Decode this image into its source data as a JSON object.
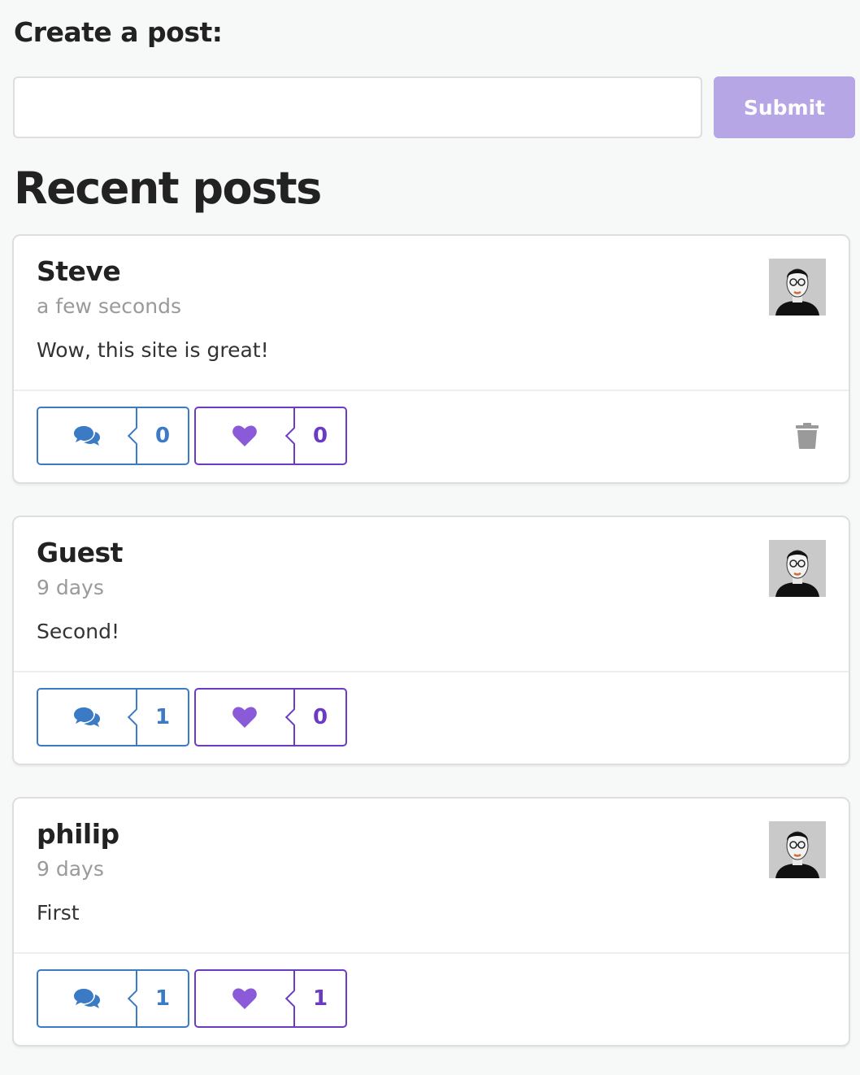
{
  "create": {
    "title": "Create a post:",
    "input_value": "",
    "input_placeholder": "",
    "submit_label": "Submit"
  },
  "recent": {
    "title": "Recent posts"
  },
  "colors": {
    "accent_blue": "#3b7ac5",
    "accent_purple": "#6b3bc4",
    "heart": "#8a5ad9",
    "submit_disabled": "#b6a6e6"
  },
  "posts": [
    {
      "author": "Steve",
      "time": "a few seconds",
      "body": "Wow, this site is great!",
      "comments": "0",
      "likes": "0",
      "deletable": true
    },
    {
      "author": "Guest",
      "time": "9 days",
      "body": "Second!",
      "comments": "1",
      "likes": "0",
      "deletable": false
    },
    {
      "author": "philip",
      "time": "9 days",
      "body": "First",
      "comments": "1",
      "likes": "1",
      "deletable": false
    }
  ],
  "icons": {
    "comment": "comments-icon",
    "like": "heart-icon",
    "delete": "trash-icon",
    "avatar": "user-avatar"
  }
}
